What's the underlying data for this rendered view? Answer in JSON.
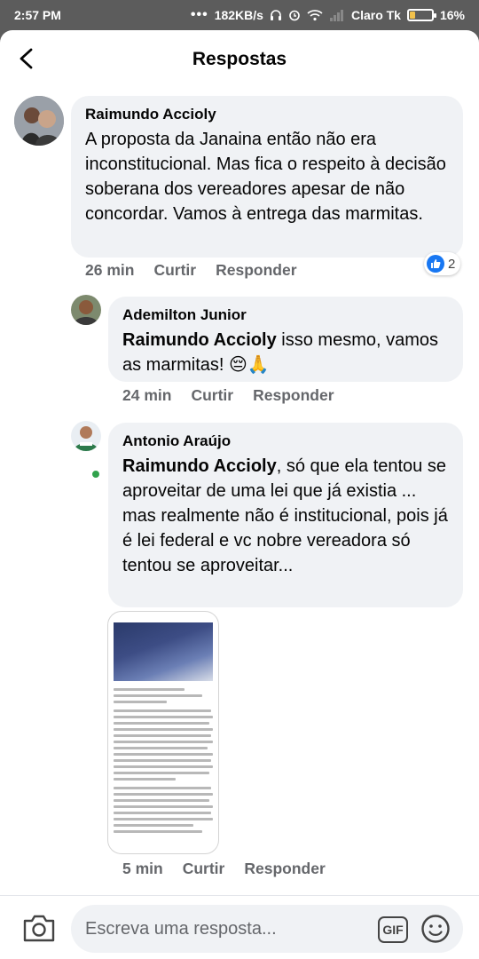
{
  "status_bar": {
    "time": "2:57 PM",
    "network_speed": "182KB/s",
    "carrier": "Claro Tk",
    "battery": "16%"
  },
  "header": {
    "title": "Respostas"
  },
  "comments": [
    {
      "author": "Raimundo Accioly",
      "text": "A proposta da Janaina então não era inconstitucional. Mas fica o respeito à decisão soberana dos vereadores apesar de não concordar. Vamos à entrega das marmitas.",
      "time": "26 min",
      "like_label": "Curtir",
      "reply_label": "Responder",
      "reaction_count": "2"
    },
    {
      "author": "Ademilton Junior",
      "mention": "Raimundo Accioly",
      "text": " isso mesmo, vamos as marmitas! 😔🙏",
      "time": "24 min",
      "like_label": "Curtir",
      "reply_label": "Responder"
    },
    {
      "author": "Antonio Araújo",
      "mention": "Raimundo Accioly",
      "text": ", só que ela tentou se aproveitar de uma lei que já existia ... mas realmente não é institucional, pois já é lei federal e vc nobre vereadora só tentou se aproveitar...",
      "time": "5 min",
      "like_label": "Curtir",
      "reply_label": "Responder"
    }
  ],
  "composer": {
    "placeholder": "Escreva uma resposta...",
    "gif_label": "GIF"
  },
  "icons": [
    "back-arrow-icon",
    "like-icon",
    "camera-icon",
    "gif-icon",
    "emoji-icon"
  ],
  "colors": {
    "facebook_blue": "#1877f2",
    "bubble": "#f0f2f5",
    "meta_text": "#65676b",
    "online": "#31a24c"
  }
}
